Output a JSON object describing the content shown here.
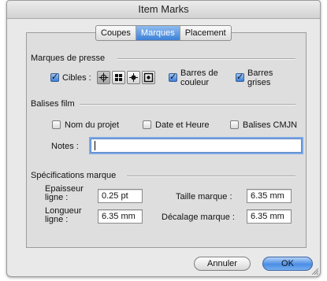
{
  "window": {
    "title": "Item Marks"
  },
  "tabs": [
    {
      "label": "Coupes",
      "selected": false
    },
    {
      "label": "Marques",
      "selected": true
    },
    {
      "label": "Placement",
      "selected": false
    }
  ],
  "press_marks": {
    "heading": "Marques de presse",
    "cibles_label": "Cibles :",
    "cibles_checked": true,
    "glyph_icons": [
      "crosshair-target-icon",
      "square-target-icon",
      "cross-target-icon",
      "frame-target-icon"
    ],
    "color_bars": {
      "line1": "Barres de",
      "line2": "couleur",
      "checked": true
    },
    "gray_bars": {
      "line1": "Barres",
      "line2": "grises",
      "checked": true
    }
  },
  "film_tags": {
    "heading": "Balises film",
    "project_name": {
      "label": "Nom du projet",
      "checked": false
    },
    "date_time": {
      "label": "Date et Heure",
      "checked": false
    },
    "cmyk_tags": {
      "label": "Balises CMJN",
      "checked": false
    },
    "notes_label": "Notes :",
    "notes_value": ""
  },
  "mark_specs": {
    "heading": "Spécifications marque",
    "line_weight": {
      "label1": "Epaisseur",
      "label2": "ligne :",
      "value": "0.25 pt"
    },
    "line_length": {
      "label1": "Longueur",
      "label2": "ligne :",
      "value": "6.35 mm"
    },
    "mark_size": {
      "label": "Taille marque :",
      "value": "6.35 mm"
    },
    "mark_offset": {
      "label": "Décalage marque :",
      "value": "6.35 mm"
    }
  },
  "buttons": {
    "cancel": "Annuler",
    "ok": "OK"
  },
  "colors": {
    "accent": "#3c80d6",
    "dialog_bg": "#e9e9e9",
    "panel_bg": "#dedede"
  }
}
